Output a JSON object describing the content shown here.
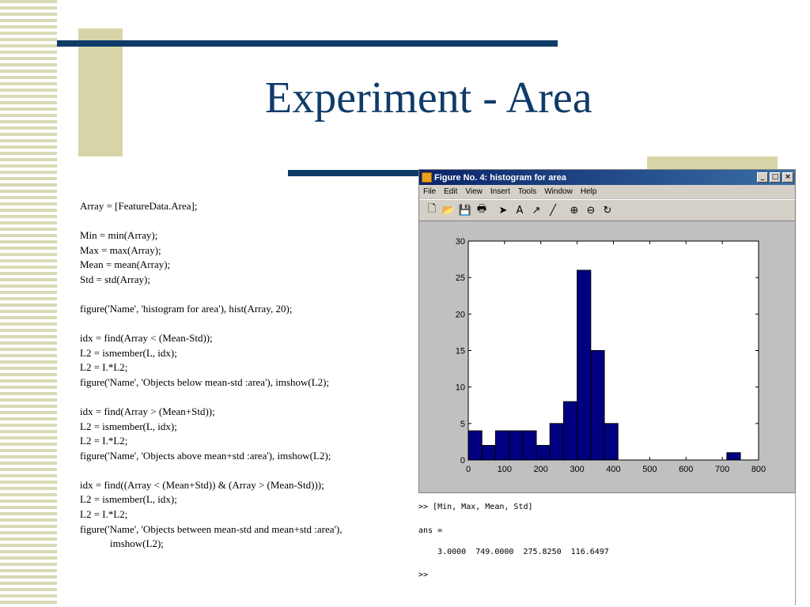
{
  "slide": {
    "title": "Experiment - Area",
    "code_groups": [
      {
        "lines": [
          "Array = [FeatureData.Area];"
        ]
      },
      {
        "lines": [
          "Min = min(Array);",
          "Max = max(Array);",
          "Mean = mean(Array);",
          "Std = std(Array);"
        ]
      },
      {
        "lines": [
          "figure('Name', 'histogram for area'), hist(Array, 20);"
        ]
      },
      {
        "lines": [
          "idx = find(Array < (Mean-Std));",
          "L2 = ismember(L, idx);",
          "L2 = I.*L2;",
          "figure('Name', 'Objects below mean-std :area'), imshow(L2);"
        ]
      },
      {
        "lines": [
          "idx = find(Array > (Mean+Std));",
          "L2 = ismember(L, idx);",
          "L2 = I.*L2;",
          "figure('Name', 'Objects above mean+std :area'), imshow(L2);"
        ]
      },
      {
        "lines": [
          "idx = find((Array < (Mean+Std)) & (Array > (Mean-Std)));",
          "L2 = ismember(L, idx);",
          "L2 = I.*L2;",
          "figure('Name', 'Objects between mean-std and mean+std :area'),",
          "imshow(L2);"
        ]
      }
    ]
  },
  "figure_window": {
    "title": "Figure No. 4: histogram for area",
    "buttons": {
      "minimize": "_",
      "maximize": "□",
      "close": "×"
    },
    "menu": [
      "File",
      "Edit",
      "View",
      "Insert",
      "Tools",
      "Window",
      "Help"
    ],
    "toolbar": [
      {
        "name": "new-figure-icon",
        "glyph": "🗋"
      },
      {
        "name": "open-file-icon",
        "glyph": "📂"
      },
      {
        "name": "save-icon",
        "glyph": "💾"
      },
      {
        "name": "print-icon",
        "glyph": "🖶"
      },
      {
        "sep": true
      },
      {
        "name": "edit-plot-arrow-icon",
        "glyph": "➤"
      },
      {
        "name": "insert-text-icon",
        "glyph": "A"
      },
      {
        "name": "insert-arrow-icon",
        "glyph": "↗"
      },
      {
        "name": "insert-line-icon",
        "glyph": "╱"
      },
      {
        "sep": true
      },
      {
        "name": "zoom-in-icon",
        "glyph": "⊕"
      },
      {
        "name": "zoom-out-icon",
        "glyph": "⊖"
      },
      {
        "name": "rotate-3d-icon",
        "glyph": "↻"
      }
    ]
  },
  "chart_data": {
    "type": "bar",
    "bin_edges": [
      0,
      37.5,
      75,
      112.5,
      150,
      187.5,
      225,
      262.5,
      300,
      337.5,
      375,
      412.5,
      450,
      487.5,
      525,
      562.5,
      600,
      637.5,
      675,
      712.5,
      750
    ],
    "values": [
      4,
      2,
      4,
      4,
      4,
      2,
      5,
      8,
      26,
      15,
      5,
      0,
      0,
      0,
      0,
      0,
      0,
      0,
      0,
      1
    ],
    "xlim": [
      0,
      800
    ],
    "ylim": [
      0,
      30
    ],
    "xticks": [
      0,
      100,
      200,
      300,
      400,
      500,
      600,
      700,
      800
    ],
    "yticks": [
      0,
      5,
      10,
      15,
      20,
      25,
      30
    ],
    "bar_color": "#000080",
    "grid": false
  },
  "console": {
    "command": ">> [Min, Max, Mean, Std]",
    "ans_label": "ans =",
    "result": "    3.0000  749.0000  275.8250  116.6497",
    "prompt": ">>"
  }
}
